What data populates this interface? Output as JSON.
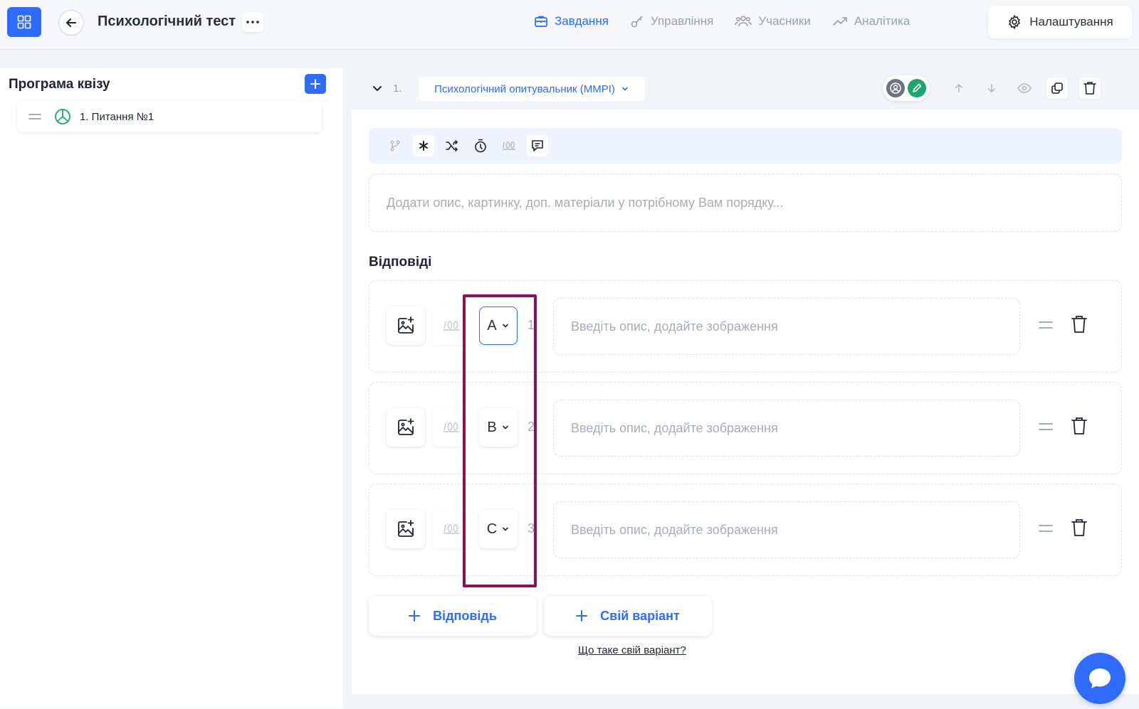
{
  "header": {
    "title": "Психологічний тест",
    "nav": [
      {
        "label": "Завдання",
        "icon": "briefcase-icon",
        "active": true
      },
      {
        "label": "Управління",
        "icon": "key-icon",
        "active": false
      },
      {
        "label": "Учасники",
        "icon": "users-icon",
        "active": false
      },
      {
        "label": "Аналітика",
        "icon": "trend-icon",
        "active": false
      }
    ],
    "settings_label": "Налаштування"
  },
  "sidebar": {
    "title": "Програма квізу",
    "items": [
      {
        "label": "1. Питання №1"
      }
    ]
  },
  "question": {
    "number": "1.",
    "type_label": "Психологічний опитувальник (MMPI)",
    "description_placeholder": "Додати опис, картинку, доп. матеріали у потрібному Вам порядку...",
    "answers_title": "Відповіді",
    "answers": [
      {
        "number": "1.",
        "letter": "A",
        "placeholder": "Введіть опис, додайте зображення"
      },
      {
        "number": "2.",
        "letter": "B",
        "placeholder": "Введіть опис, додайте зображення"
      },
      {
        "number": "3.",
        "letter": "C",
        "placeholder": "Введіть опис, додайте зображення"
      }
    ],
    "add_answer_label": "Відповідь",
    "add_custom_label": "Свій варіант",
    "custom_help_link": "Що таке свій варіант?"
  },
  "colors": {
    "accent": "#2f6bff",
    "highlight": "#8a1454",
    "role_edit": "#1ea672",
    "role_view": "#6e7380"
  }
}
